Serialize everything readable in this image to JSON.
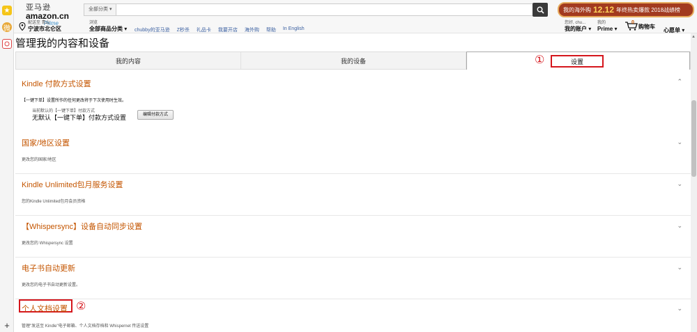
{
  "rail": {
    "star_label": "★",
    "weibo_label": "微",
    "plus_label": "+"
  },
  "header": {
    "logo_cn": "亚马逊",
    "logo_en": "amazon.cn",
    "logo_prime": "Prime",
    "search_category": "全部分类 ▾",
    "search_placeholder": "",
    "banner_prefix": "我的海外购",
    "banner_big": "12.12",
    "banner_suffix": "年终热卖爆款 2018战绩榜",
    "location_line1": "配送至  青山",
    "location_line2": "宁波市北仑区",
    "shopcat_line1": "浏览",
    "shopcat_line2": "全部商品分类 ▾",
    "nav_links": [
      "chubby的亚马逊",
      "Z秒杀",
      "礼品卡",
      "我要开店",
      "海外购",
      "帮助",
      "In English"
    ],
    "account_line1": "您好, chu...",
    "account_line2": "我的账户 ▾",
    "prime_line1": "我的",
    "prime_line2": "Prime ▾",
    "cart_count": "0",
    "cart_label": "购物车",
    "wishlist_label": "心愿单 ▾"
  },
  "page": {
    "title": "管理我的内容和设备"
  },
  "tabs": {
    "content": "我的内容",
    "devices": "我的设备",
    "settings": "设置"
  },
  "annotations": {
    "one": "①",
    "two": "②"
  },
  "sections": {
    "kindle_pay": {
      "title": "Kindle 付款方式设置",
      "desc": "【一键下单】设置所作的任何更改将于下次使用时生效。",
      "sub_label": "当前默认的【一键下单】付款方式",
      "sub_value": "无默认【一键下单】付款方式设置",
      "button": "编辑付款方式"
    },
    "country": {
      "title": "国家/地区设置",
      "desc": "更改您的国家/地区"
    },
    "unlimited": {
      "title": "Kindle Unlimited包月服务设置",
      "desc": "您的Kindle Unlimited包月会员资格"
    },
    "whispersync": {
      "title": "【Whispersync】设备自动同步设置",
      "desc": "更改您的 Whispersync 设置"
    },
    "autoupdate": {
      "title": "电子书自动更新",
      "desc": "更改您的电子书自动更新设置。"
    },
    "personal_docs": {
      "title": "个人文档设置",
      "desc": "管理\"发送至 Kindle\"电子邮箱、个人文档存档和 Whispernet 传送设置"
    }
  }
}
